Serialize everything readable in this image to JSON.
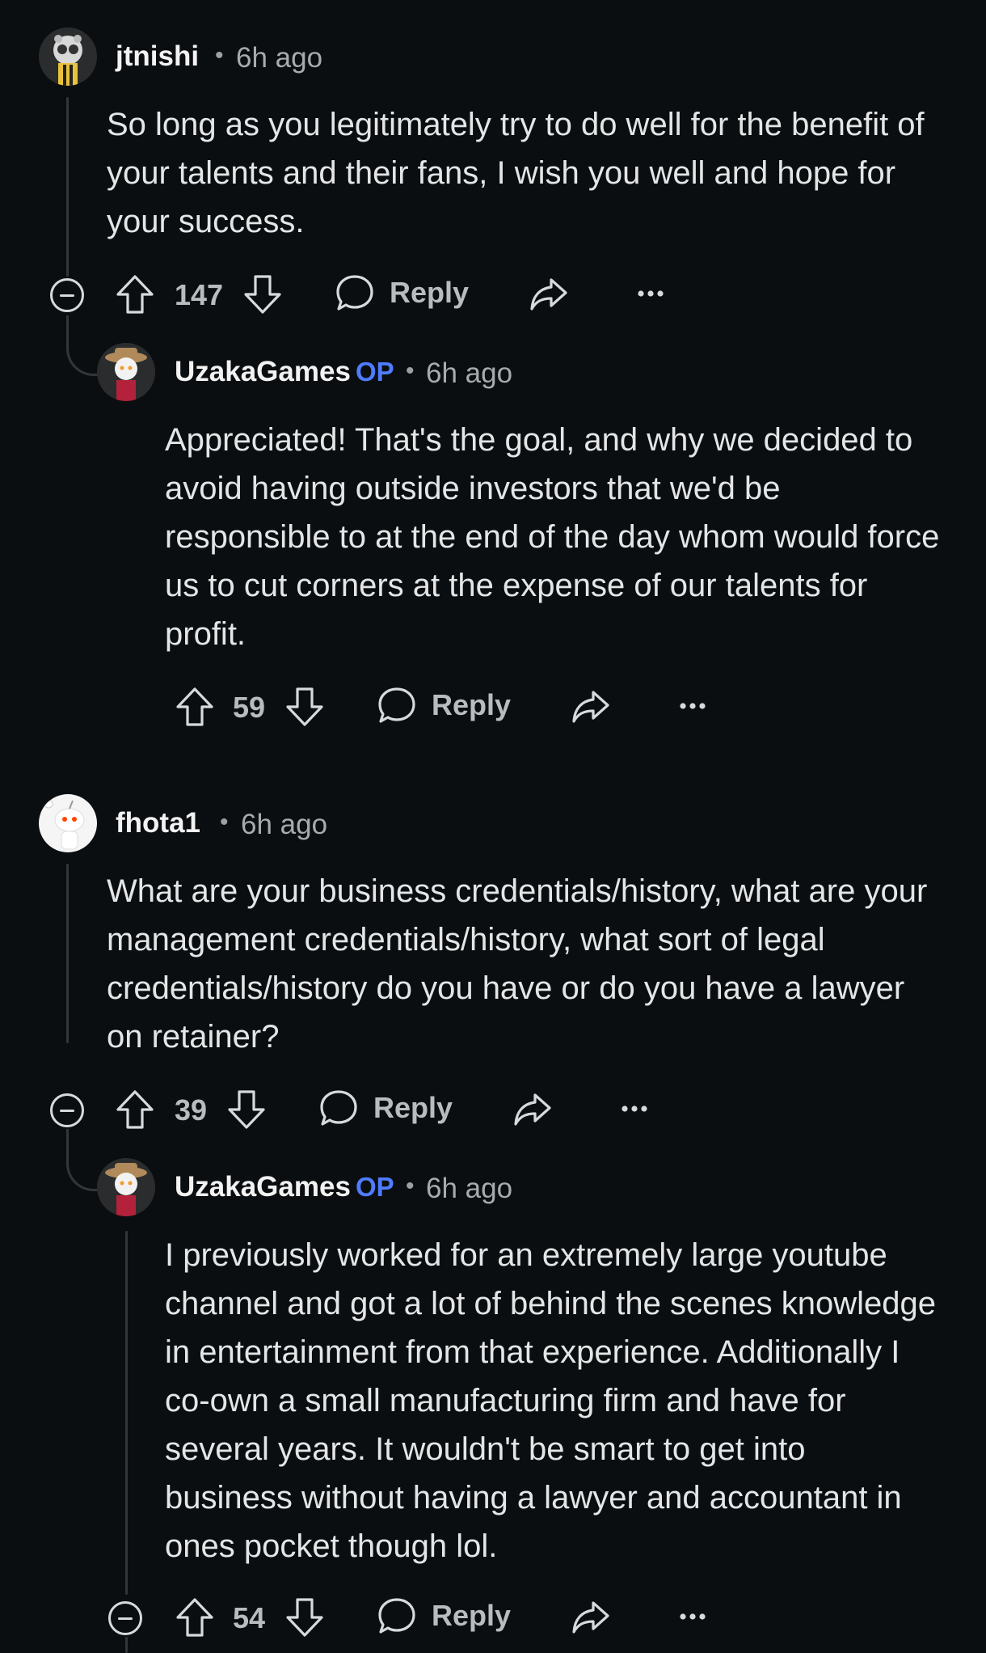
{
  "comments": [
    {
      "username": "jtnishi",
      "time": "6h ago",
      "text": "So long as you legitimately try to do well for the benefit of your talents and their fans, I wish you well and hope for your success.",
      "votes": "147",
      "reply_label": "Reply"
    },
    {
      "username": "UzakaGames",
      "op_badge": "OP",
      "time": "6h ago",
      "text": "Appreciated! That's the goal, and why we decided to avoid having outside investors that we'd be responsible to at the end of the day whom would force us to cut corners at the expense of our talents for profit.",
      "votes": "59",
      "reply_label": "Reply"
    },
    {
      "username": "fhota1",
      "time": "6h ago",
      "text": "What are your business credentials/history, what are your management credentials/history, what sort of legal credentials/history do you have or do you have a lawyer on retainer?",
      "votes": "39",
      "reply_label": "Reply"
    },
    {
      "username": "UzakaGames",
      "op_badge": "OP",
      "time": "6h ago",
      "text": "I previously worked for an extremely large youtube channel and got a lot of behind the scenes knowledge in entertainment from that experience. Additionally I co-own a small manufacturing firm and have for several years. It wouldn't be smart to get into business without having a lawyer and accountant in ones pocket though lol.",
      "votes": "54",
      "reply_label": "Reply"
    }
  ],
  "icons": {
    "upvote": "upvote-icon",
    "downvote": "downvote-icon",
    "reply": "reply-bubble-icon",
    "share": "share-icon",
    "more": "more-options-icon",
    "collapse": "collapse-icon"
  },
  "colors": {
    "background": "#0b0e10",
    "op_badge": "#4f7cff",
    "text": "#e3e5e6",
    "muted": "#a8abad"
  }
}
